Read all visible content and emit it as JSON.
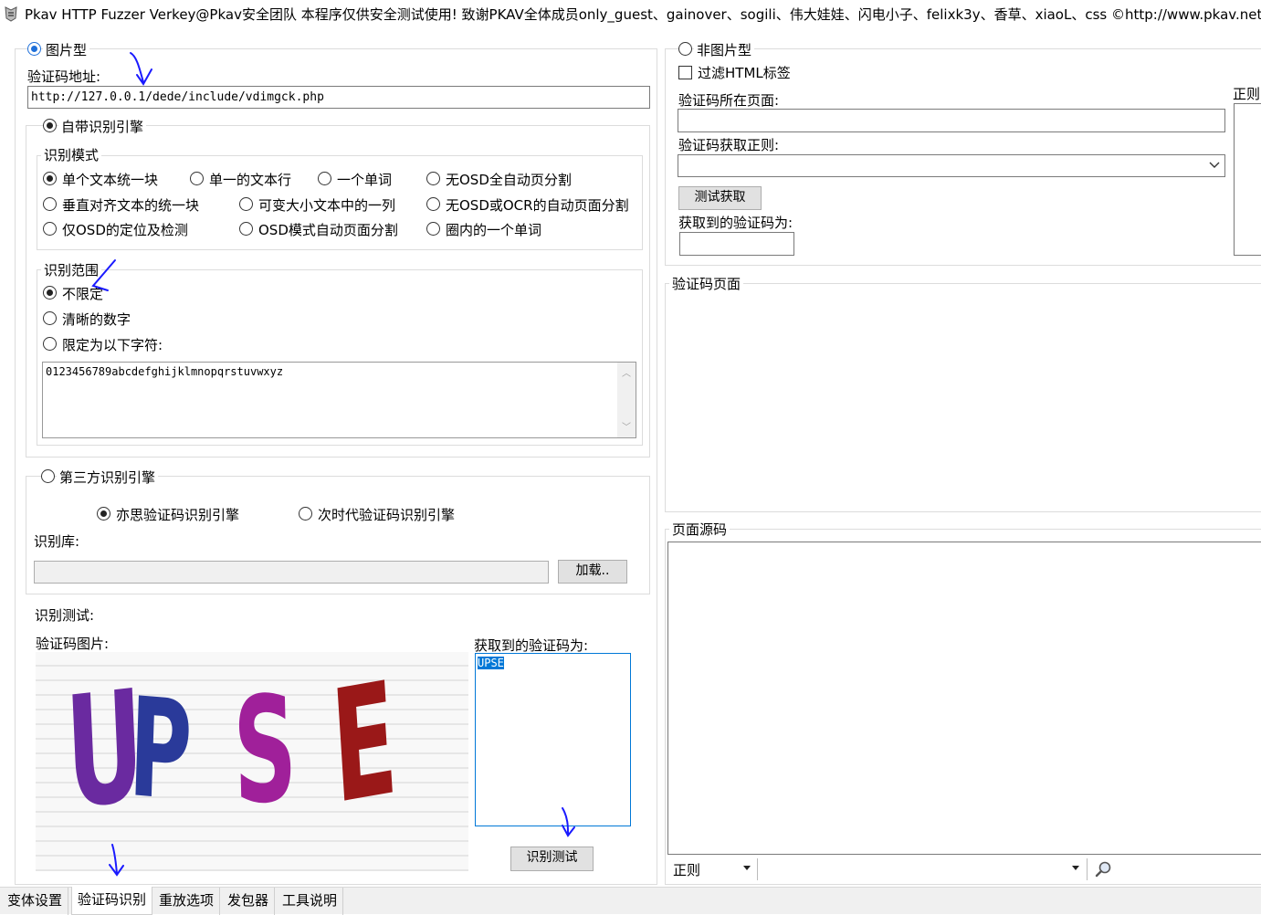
{
  "window": {
    "title": "Pkav HTTP Fuzzer   Verkey@Pkav安全团队  本程序仅供安全测试使用!  致谢PKAV全体成员only_guest、gainover、sogili、伟大娃娃、闪电小子、felixk3y、香草、xiaoL、css  ©http://www.pkav.net"
  },
  "left": {
    "mode_image_label": "图片型",
    "captcha_url_label": "验证码地址:",
    "captcha_url_value": "http://127.0.0.1/dede/include/vdimgck.php",
    "builtin_engine_label": "自带识别引擎",
    "recognition_mode": {
      "legend": "识别模式",
      "options": [
        {
          "label": "单个文本统一块",
          "checked": true
        },
        {
          "label": "单一的文本行",
          "checked": false
        },
        {
          "label": "一个单词",
          "checked": false
        },
        {
          "label": "无OSD全自动页分割",
          "checked": false
        },
        {
          "label": "垂直对齐文本的统一块",
          "checked": false
        },
        {
          "label": "可变大小文本中的一列",
          "checked": false
        },
        {
          "label": "无OSD或OCR的自动页面分割",
          "checked": false
        },
        {
          "label": "仅OSD的定位及检测",
          "checked": false
        },
        {
          "label": "OSD模式自动页面分割",
          "checked": false
        },
        {
          "label": "圈内的一个单词",
          "checked": false
        }
      ]
    },
    "recognition_range": {
      "legend": "识别范围",
      "options": [
        {
          "label": "不限定",
          "checked": true
        },
        {
          "label": "清晰的数字",
          "checked": false
        },
        {
          "label": "限定为以下字符:",
          "checked": false
        }
      ],
      "charset_value": "0123456789abcdefghijklmnopqrstuvwxyz"
    },
    "third_party": {
      "label": "第三方识别引擎",
      "option_a": "亦思验证码识别引擎",
      "option_b": "次时代验证码识别引擎",
      "library_label": "识别库:",
      "library_value": "",
      "load_button": "加载.."
    },
    "test": {
      "legend": "识别测试:",
      "image_label": "验证码图片:",
      "result_label": "获取到的验证码为:",
      "result_value": "UPSE",
      "captcha_chars": [
        "U",
        "P",
        "S",
        "E"
      ],
      "test_button": "识别测试"
    }
  },
  "right": {
    "mode_nonimage_label": "非图片型",
    "filter_html_label": "过滤HTML标签",
    "page_label": "验证码所在页面:",
    "page_value": "",
    "regex_label": "验证码获取正则:",
    "regex_value": "",
    "test_fetch_button": "测试获取",
    "fetched_label": "获取到的验证码为:",
    "fetched_value": "",
    "regex_side_label": "正则",
    "captcha_page_legend": "验证码页面",
    "source_legend": "页面源码",
    "bottom_filter_select": "正则",
    "bottom_search_value": ""
  },
  "tabs": [
    {
      "label": "变体设置",
      "active": false
    },
    {
      "label": "验证码识别",
      "active": true
    },
    {
      "label": "重放选项",
      "active": false
    },
    {
      "label": "发包器",
      "active": false
    },
    {
      "label": "工具说明",
      "active": false
    }
  ],
  "colors": {
    "accent_blue": "#1e6fd9",
    "annotation_ink": "#1a1aff",
    "highlight": "#0078d7"
  }
}
